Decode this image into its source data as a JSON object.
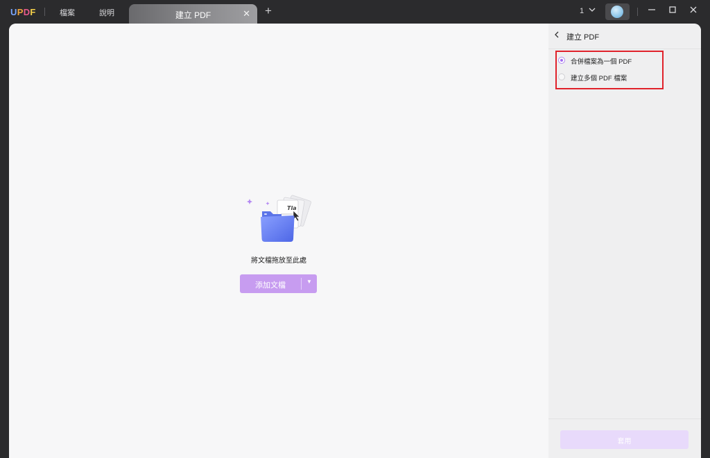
{
  "app": {
    "logo": "UPDF",
    "menu": [
      "檔案",
      "說明"
    ]
  },
  "tabs": [
    {
      "label": "建立 PDF",
      "active": true
    }
  ],
  "topbar": {
    "page_indicator": "1",
    "icons": {
      "add_tab": "plus-icon",
      "close_tab": "close-icon",
      "dropdown": "chevron-down-icon",
      "minimize": "minimize-icon",
      "maximize": "maximize-icon",
      "close_window": "close-icon"
    }
  },
  "main": {
    "drop_label": "將文檔拖放至此處",
    "add_button_label": "添加文檔",
    "illustration": "folder-with-documents-illustration"
  },
  "panel": {
    "title": "建立 PDF",
    "options": [
      {
        "label": "合併檔案為一個 PDF",
        "selected": true
      },
      {
        "label": "建立多個 PDF 檔案",
        "selected": false
      }
    ],
    "apply_label": "套用"
  },
  "colors": {
    "accent": "#c79cf0",
    "radio_accent": "#a36ef2",
    "highlight_box": "#e0212a",
    "titlebar_bg": "#2b2b2d"
  }
}
